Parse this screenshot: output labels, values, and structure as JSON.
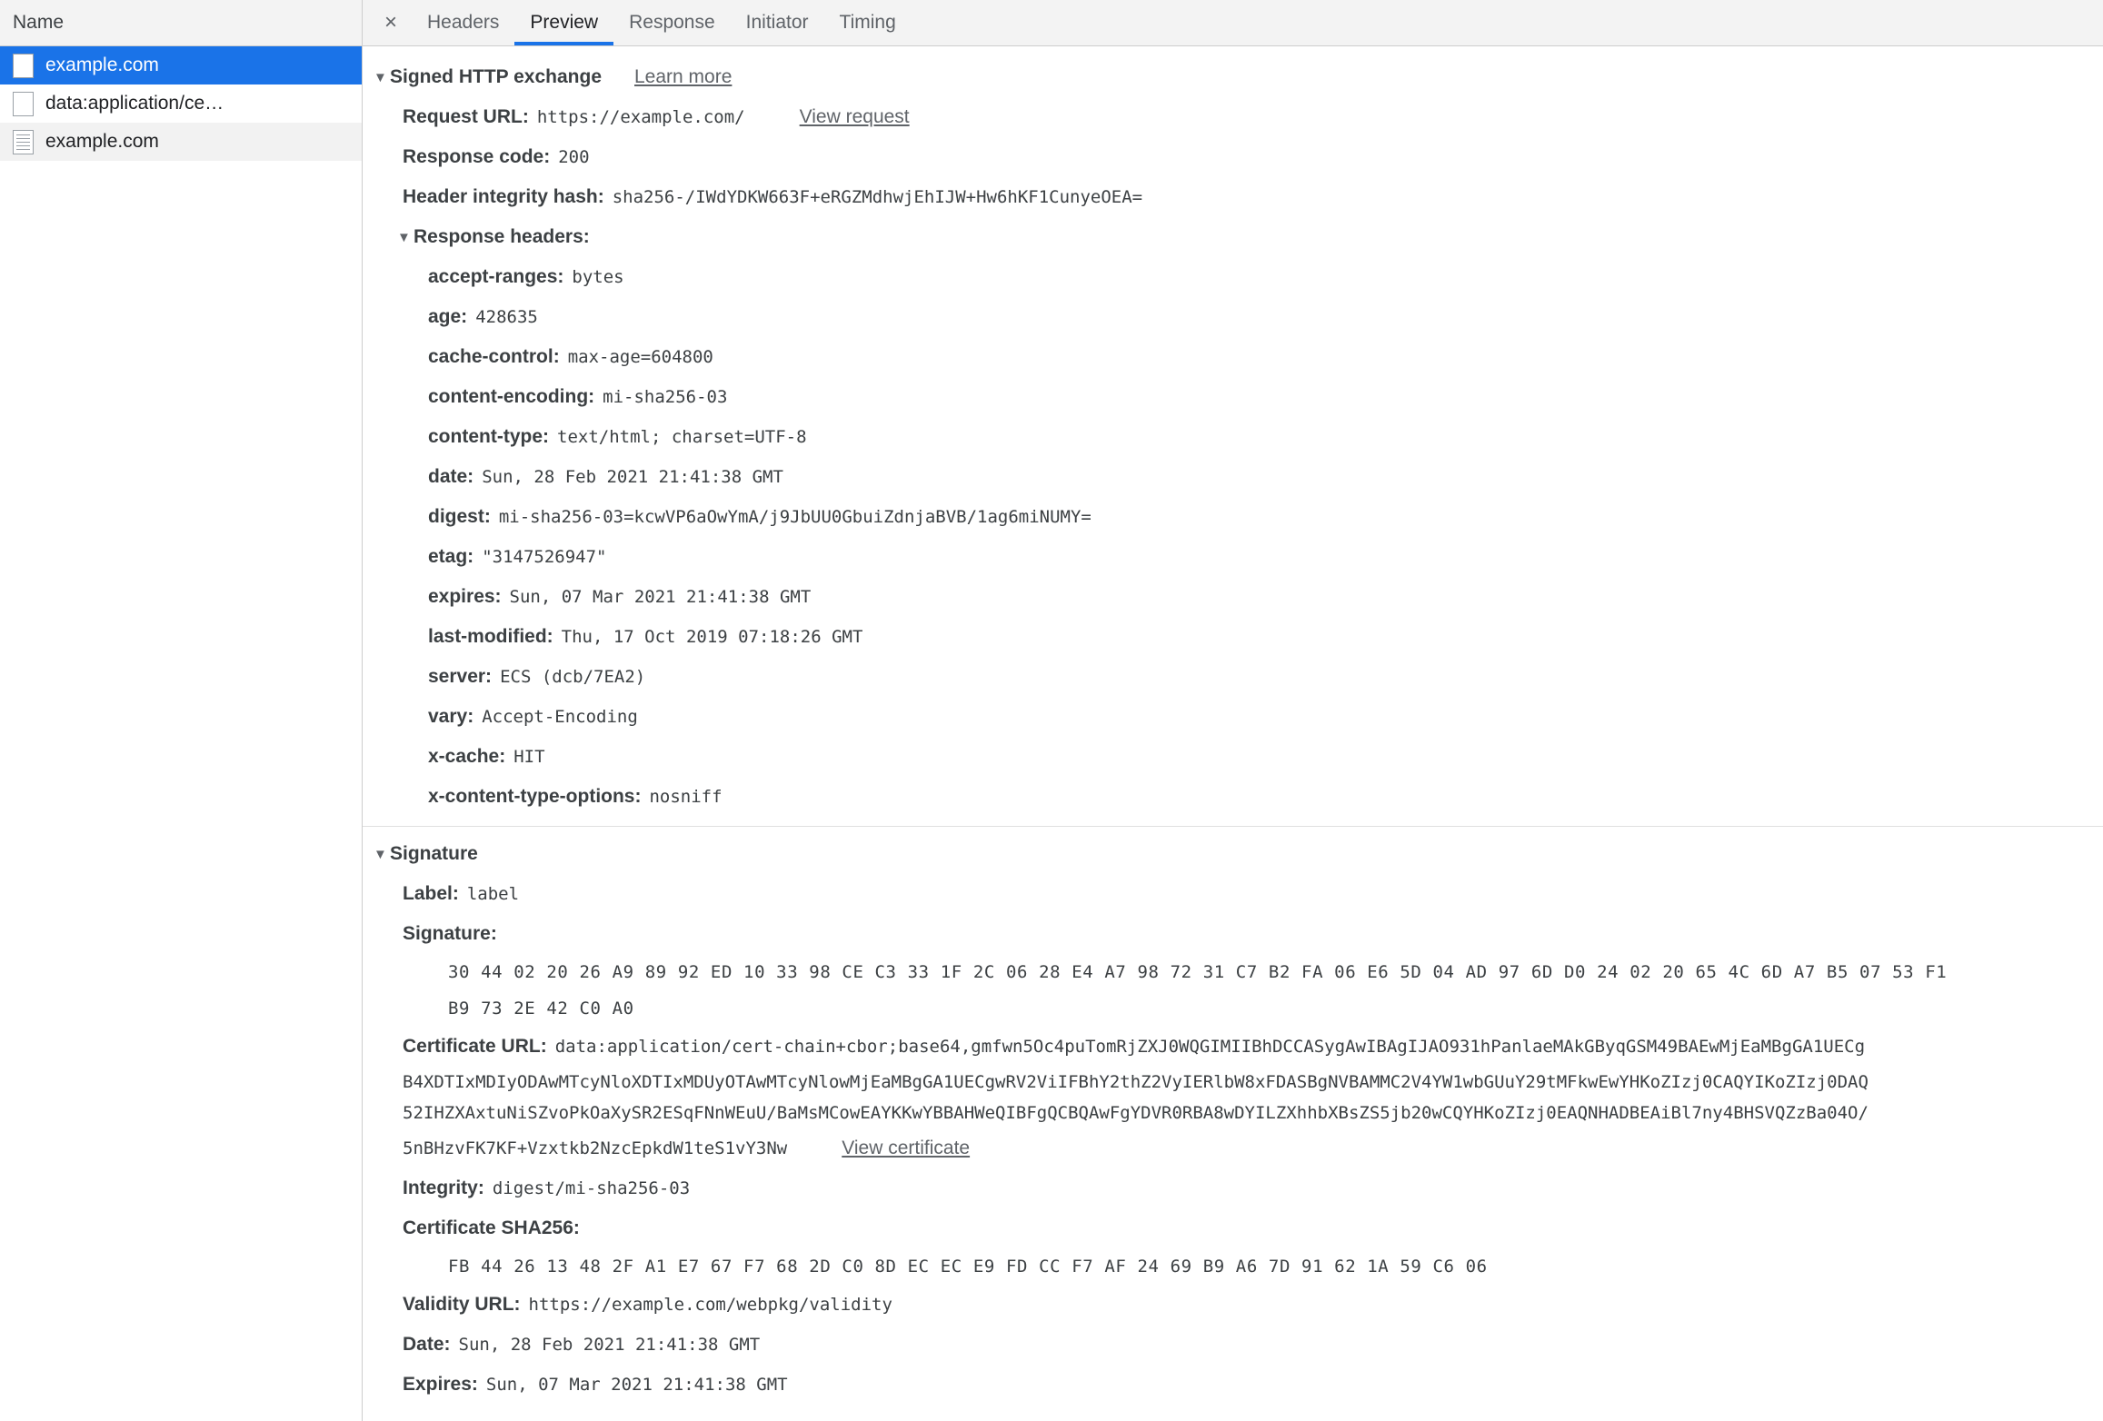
{
  "left_panel": {
    "column_header": "Name",
    "rows": [
      {
        "label": "example.com",
        "icon": "blank-document-icon",
        "selected": true
      },
      {
        "label": "data:application/ce…",
        "icon": "blank-document-icon",
        "selected": false
      },
      {
        "label": "example.com",
        "icon": "lined-document-icon",
        "selected": false
      }
    ]
  },
  "tabbar": {
    "close_label": "×",
    "tabs": [
      {
        "label": "Headers",
        "active": false
      },
      {
        "label": "Preview",
        "active": true
      },
      {
        "label": "Response",
        "active": false
      },
      {
        "label": "Initiator",
        "active": false
      },
      {
        "label": "Timing",
        "active": false
      }
    ]
  },
  "signed_exchange": {
    "title": "Signed HTTP exchange",
    "learn_more": "Learn more",
    "twisty": "▼",
    "request_url_key": "Request URL:",
    "request_url_value": "https://example.com/",
    "view_request": "View request",
    "response_code_key": "Response code:",
    "response_code_value": "200",
    "header_integrity_key": "Header integrity hash:",
    "header_integrity_value": "sha256-/IWdYDKW663F+eRGZMdhwjEhIJW+Hw6hKF1CunyeOEA=",
    "response_headers_title": "Response headers:",
    "response_headers": [
      {
        "name": "accept-ranges:",
        "value": "bytes"
      },
      {
        "name": "age:",
        "value": "428635"
      },
      {
        "name": "cache-control:",
        "value": "max-age=604800"
      },
      {
        "name": "content-encoding:",
        "value": "mi-sha256-03"
      },
      {
        "name": "content-type:",
        "value": "text/html; charset=UTF-8"
      },
      {
        "name": "date:",
        "value": "Sun, 28 Feb 2021 21:41:38 GMT"
      },
      {
        "name": "digest:",
        "value": "mi-sha256-03=kcwVP6aOwYmA/j9JbUU0GbuiZdnjaBVB/1ag6miNUMY="
      },
      {
        "name": "etag:",
        "value": "\"3147526947\""
      },
      {
        "name": "expires:",
        "value": "Sun, 07 Mar 2021 21:41:38 GMT"
      },
      {
        "name": "last-modified:",
        "value": "Thu, 17 Oct 2019 07:18:26 GMT"
      },
      {
        "name": "server:",
        "value": "ECS (dcb/7EA2)"
      },
      {
        "name": "vary:",
        "value": "Accept-Encoding"
      },
      {
        "name": "x-cache:",
        "value": "HIT"
      },
      {
        "name": "x-content-type-options:",
        "value": "nosniff"
      }
    ]
  },
  "signature": {
    "title": "Signature",
    "twisty": "▼",
    "label_key": "Label:",
    "label_value": "label",
    "signature_key": "Signature:",
    "signature_hex_lines": [
      "30 44 02 20 26 A9 89 92 ED 10 33 98 CE C3 33 1F 2C 06 28 E4 A7 98 72 31 C7 B2 FA 06 E6 5D 04 AD 97 6D D0 24 02 20 65 4C 6D A7 B5 07 53 F1",
      "B9 73 2E 42 C0 A0"
    ],
    "certificate_url_key": "Certificate URL:",
    "certificate_url_lines": [
      "data:application/cert-chain+cbor;base64,gmfwn5Oc4puTomRjZXJ0WQGIMIIBhDCCASygAwIBAgIJAO931hPanlaeMAkGByqGSM49BAEwMjEaMBgGA1UECg",
      "B4XDTIxMDIyODAwMTcyNloXDTIxMDUyOTAwMTcyNlowMjEaMBgGA1UECgwRV2ViIFBhY2thZ2VyIERlbW8xFDASBgNVBAMMC2V4YW1wbGUuY29tMFkwEwYHKoZIzj0CAQYIKoZIzj0DAQ",
      "52IHZXAxtuNiSZvoPkOaXySR2ESqFNnWEuU/BaMsMCowEAYKKwYBBAHWeQIBFgQCBQAwFgYDVR0RBA8wDYILZXhhbXBsZS5jb20wCQYHKoZIzj0EAQNHADBEAiBl7ny4BHSVQZzBa04O/",
      "5nBHzvFK7KF+Vzxtkb2NzcEpkdW1teS1vY3Nw"
    ],
    "view_certificate": "View certificate",
    "integrity_key": "Integrity:",
    "integrity_value": "digest/mi-sha256-03",
    "certificate_sha256_key": "Certificate SHA256:",
    "certificate_sha256_value": "FB 44 26 13 48 2F A1 E7 67 F7 68 2D C0 8D EC EC E9 FD CC F7 AF 24 69 B9 A6 7D 91 62 1A 59 C6 06",
    "validity_url_key": "Validity URL:",
    "validity_url_value": "https://example.com/webpkg/validity",
    "date_key": "Date:",
    "date_value": "Sun, 28 Feb 2021 21:41:38 GMT",
    "expires_key": "Expires:",
    "expires_value": "Sun, 07 Mar 2021 21:41:38 GMT"
  },
  "colors": {
    "selection_blue": "#1a73e8",
    "text": "#3c4043",
    "muted": "#5f6368"
  }
}
